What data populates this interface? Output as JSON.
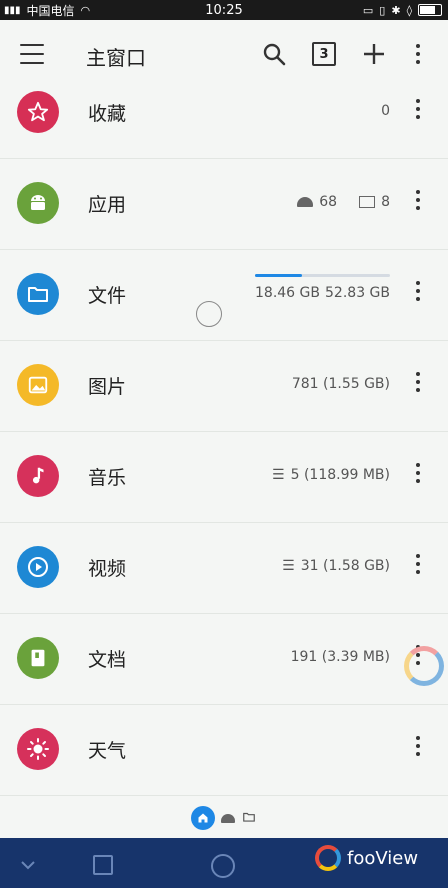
{
  "status_bar": {
    "carrier": "中国电信",
    "time": "10:25"
  },
  "toolbar": {
    "title": "主窗口",
    "tab_count": "3"
  },
  "items": [
    {
      "label": "收藏",
      "info": "0",
      "color": "#d62f55",
      "icon": "star-icon"
    },
    {
      "label": "应用",
      "apps_count": "68",
      "images_count": "8",
      "color": "#6aa23b",
      "icon": "android-icon"
    },
    {
      "label": "文件",
      "used": "18.46 GB",
      "total": "52.83 GB",
      "usage_fraction": 0.35,
      "color": "#1e88d4",
      "icon": "folder-icon"
    },
    {
      "label": "图片",
      "info": "781 (1.55 GB)",
      "color": "#f4b928",
      "icon": "image-icon"
    },
    {
      "label": "音乐",
      "info": "5 (118.99 MB)",
      "color": "#d6315b",
      "icon": "music-note-icon"
    },
    {
      "label": "视频",
      "info": "31 (1.58 GB)",
      "color": "#1e88d4",
      "icon": "play-icon"
    },
    {
      "label": "文档",
      "info": "191 (3.39 MB)",
      "color": "#6aa23b",
      "icon": "book-icon"
    },
    {
      "label": "天气",
      "color": "#d6315b",
      "icon": "sun-icon"
    }
  ],
  "watermark": {
    "text": "fooView"
  }
}
